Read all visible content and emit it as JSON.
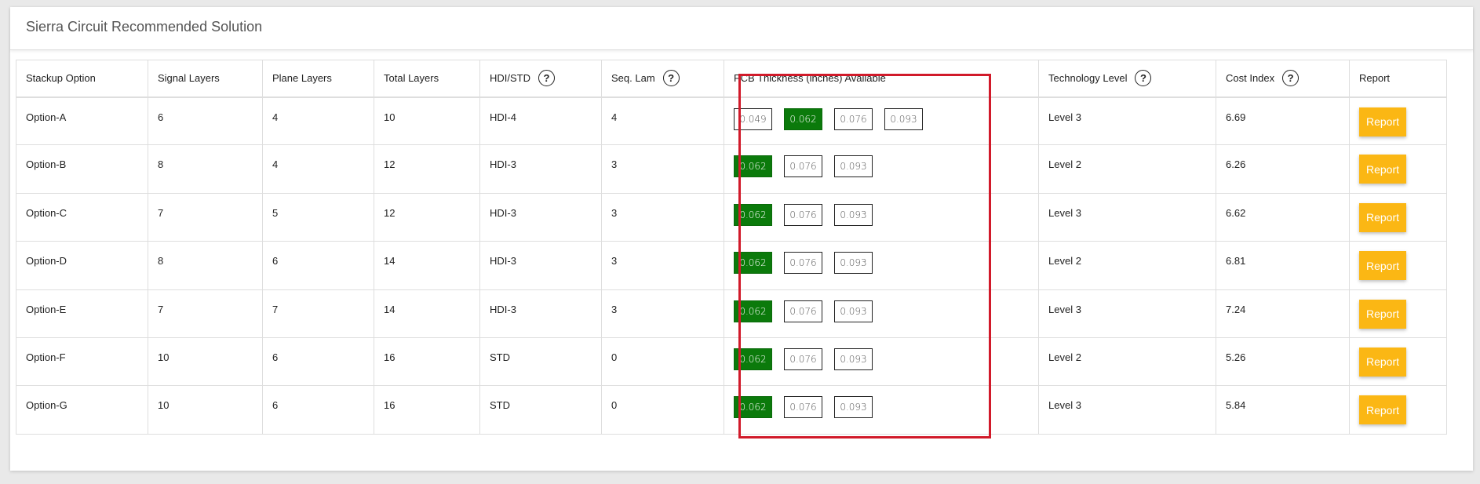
{
  "panel": {
    "title": "Sierra Circuit Recommended Solution"
  },
  "columns": [
    {
      "label": "Stackup Option",
      "help": false
    },
    {
      "label": "Signal Layers",
      "help": false
    },
    {
      "label": "Plane Layers",
      "help": false
    },
    {
      "label": "Total Layers",
      "help": false
    },
    {
      "label": "HDI/STD",
      "help": true
    },
    {
      "label": "Seq. Lam",
      "help": true
    },
    {
      "label": "PCB Thickness (inches) Available",
      "help": false
    },
    {
      "label": "Technology Level",
      "help": true
    },
    {
      "label": "Cost Index",
      "help": true
    },
    {
      "label": "Report",
      "help": false
    }
  ],
  "help_icon_glyph": "?",
  "rows": [
    {
      "option": "Option-A",
      "signal": "6",
      "plane": "4",
      "total": "10",
      "hdi": "HDI-4",
      "seq": "4",
      "thickness": [
        "0.049",
        "0.062",
        "0.076",
        "0.093"
      ],
      "selected": "0.062",
      "tech": "Level 3",
      "cost": "6.69",
      "report": "Report"
    },
    {
      "option": "Option-B",
      "signal": "8",
      "plane": "4",
      "total": "12",
      "hdi": "HDI-3",
      "seq": "3",
      "thickness": [
        "0.062",
        "0.076",
        "0.093"
      ],
      "selected": "0.062",
      "tech": "Level 2",
      "cost": "6.26",
      "report": "Report"
    },
    {
      "option": "Option-C",
      "signal": "7",
      "plane": "5",
      "total": "12",
      "hdi": "HDI-3",
      "seq": "3",
      "thickness": [
        "0.062",
        "0.076",
        "0.093"
      ],
      "selected": "0.062",
      "tech": "Level 3",
      "cost": "6.62",
      "report": "Report"
    },
    {
      "option": "Option-D",
      "signal": "8",
      "plane": "6",
      "total": "14",
      "hdi": "HDI-3",
      "seq": "3",
      "thickness": [
        "0.062",
        "0.076",
        "0.093"
      ],
      "selected": "0.062",
      "tech": "Level 2",
      "cost": "6.81",
      "report": "Report"
    },
    {
      "option": "Option-E",
      "signal": "7",
      "plane": "7",
      "total": "14",
      "hdi": "HDI-3",
      "seq": "3",
      "thickness": [
        "0.062",
        "0.076",
        "0.093"
      ],
      "selected": "0.062",
      "tech": "Level 3",
      "cost": "7.24",
      "report": "Report"
    },
    {
      "option": "Option-F",
      "signal": "10",
      "plane": "6",
      "total": "16",
      "hdi": "STD",
      "seq": "0",
      "thickness": [
        "0.062",
        "0.076",
        "0.093"
      ],
      "selected": "0.062",
      "tech": "Level 2",
      "cost": "5.26",
      "report": "Report"
    },
    {
      "option": "Option-G",
      "signal": "10",
      "plane": "6",
      "total": "16",
      "hdi": "STD",
      "seq": "0",
      "thickness": [
        "0.062",
        "0.076",
        "0.093"
      ],
      "selected": "0.062",
      "tech": "Level 3",
      "cost": "5.84",
      "report": "Report"
    }
  ],
  "colors": {
    "selected_thickness": "#0b7a0b",
    "report_button": "#fbb714",
    "highlight_border": "#d11a2a"
  }
}
